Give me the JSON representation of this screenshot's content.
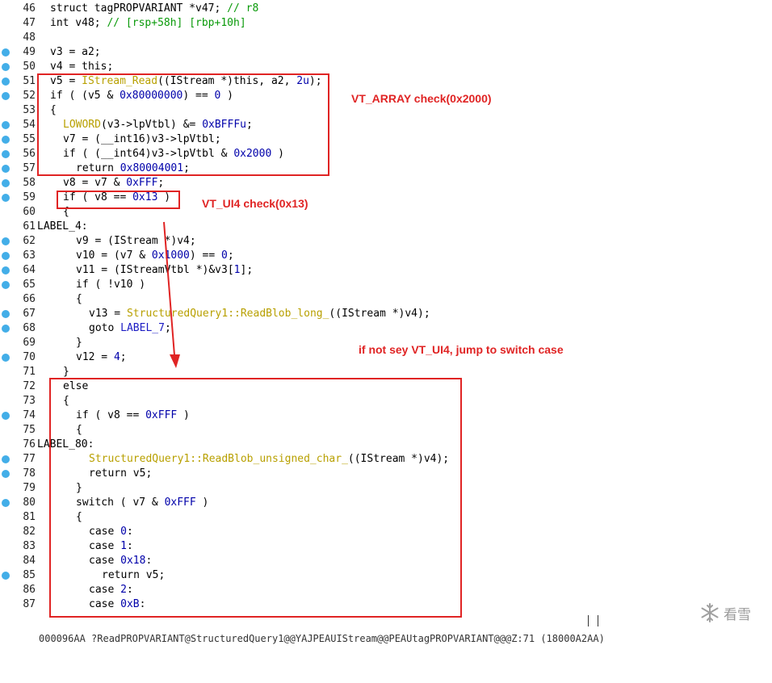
{
  "lines": [
    {
      "num": "46",
      "bp": false,
      "indent": 0,
      "tokens": [
        {
          "t": "struct tagPROPVARIANT *v47; ",
          "c": "p"
        },
        {
          "t": "// r8",
          "c": "c"
        }
      ]
    },
    {
      "num": "47",
      "bp": false,
      "indent": 0,
      "tokens": [
        {
          "t": "int v48; ",
          "c": "p"
        },
        {
          "t": "// [rsp+58h] [rbp+10h]",
          "c": "c"
        }
      ]
    },
    {
      "num": "48",
      "bp": false,
      "indent": 0,
      "tokens": []
    },
    {
      "num": "49",
      "bp": true,
      "indent": 0,
      "tokens": [
        {
          "t": "v3 = a2;",
          "c": "p"
        }
      ]
    },
    {
      "num": "50",
      "bp": true,
      "indent": 0,
      "tokens": [
        {
          "t": "v4 = this;",
          "c": "p"
        }
      ]
    },
    {
      "num": "51",
      "bp": true,
      "indent": 0,
      "tokens": [
        {
          "t": "v5 = ",
          "c": "p"
        },
        {
          "t": "IStream_Read",
          "c": "f"
        },
        {
          "t": "((IStream *)this, a2, ",
          "c": "p"
        },
        {
          "t": "2u",
          "c": "n"
        },
        {
          "t": ");",
          "c": "p"
        }
      ]
    },
    {
      "num": "52",
      "bp": true,
      "indent": 0,
      "tokens": [
        {
          "t": "if ( (v5 & ",
          "c": "p"
        },
        {
          "t": "0x80000000",
          "c": "n"
        },
        {
          "t": ") == ",
          "c": "p"
        },
        {
          "t": "0",
          "c": "n"
        },
        {
          "t": " )",
          "c": "p"
        }
      ]
    },
    {
      "num": "53",
      "bp": false,
      "indent": 0,
      "tokens": [
        {
          "t": "{",
          "c": "p"
        }
      ]
    },
    {
      "num": "54",
      "bp": true,
      "indent": 1,
      "tokens": [
        {
          "t": "LOWORD",
          "c": "f"
        },
        {
          "t": "(v3->lpVtbl) &= ",
          "c": "p"
        },
        {
          "t": "0xBFFFu",
          "c": "n"
        },
        {
          "t": ";",
          "c": "p"
        }
      ]
    },
    {
      "num": "55",
      "bp": true,
      "indent": 1,
      "tokens": [
        {
          "t": "v7 = (__int16)v3->lpVtbl;",
          "c": "p"
        }
      ]
    },
    {
      "num": "56",
      "bp": true,
      "indent": 1,
      "tokens": [
        {
          "t": "if ( (__int64)v3->lpVtbl & ",
          "c": "p"
        },
        {
          "t": "0x2000",
          "c": "n"
        },
        {
          "t": " )",
          "c": "p"
        }
      ]
    },
    {
      "num": "57",
      "bp": true,
      "indent": 2,
      "tokens": [
        {
          "t": "return ",
          "c": "p"
        },
        {
          "t": "0x80004001",
          "c": "n"
        },
        {
          "t": ";",
          "c": "p"
        }
      ]
    },
    {
      "num": "58",
      "bp": true,
      "indent": 1,
      "tokens": [
        {
          "t": "v8 = v7 & ",
          "c": "p"
        },
        {
          "t": "0xFFF",
          "c": "n"
        },
        {
          "t": ";",
          "c": "p"
        }
      ]
    },
    {
      "num": "59",
      "bp": true,
      "indent": 1,
      "tokens": [
        {
          "t": "if ( v8 == ",
          "c": "p"
        },
        {
          "t": "0x13",
          "c": "n"
        },
        {
          "t": " )",
          "c": "p"
        }
      ]
    },
    {
      "num": "60",
      "bp": false,
      "indent": 1,
      "tokens": [
        {
          "t": "{",
          "c": "p"
        }
      ]
    },
    {
      "num": "61",
      "bp": false,
      "indent": 0,
      "label": true,
      "tokens": [
        {
          "t": "LABEL_4:",
          "c": "p"
        }
      ]
    },
    {
      "num": "62",
      "bp": true,
      "indent": 2,
      "tokens": [
        {
          "t": "v9 = (IStream *)v4;",
          "c": "p"
        }
      ]
    },
    {
      "num": "63",
      "bp": true,
      "indent": 2,
      "tokens": [
        {
          "t": "v10 = (v7 & ",
          "c": "p"
        },
        {
          "t": "0x1000",
          "c": "n"
        },
        {
          "t": ") == ",
          "c": "p"
        },
        {
          "t": "0",
          "c": "n"
        },
        {
          "t": ";",
          "c": "p"
        }
      ]
    },
    {
      "num": "64",
      "bp": true,
      "indent": 2,
      "tokens": [
        {
          "t": "v11 = (IStreamVtbl *)&v3[",
          "c": "p"
        },
        {
          "t": "1",
          "c": "n"
        },
        {
          "t": "];",
          "c": "p"
        }
      ]
    },
    {
      "num": "65",
      "bp": true,
      "indent": 2,
      "tokens": [
        {
          "t": "if ( !v10 )",
          "c": "p"
        }
      ]
    },
    {
      "num": "66",
      "bp": false,
      "indent": 2,
      "tokens": [
        {
          "t": "{",
          "c": "p"
        }
      ]
    },
    {
      "num": "67",
      "bp": true,
      "indent": 3,
      "tokens": [
        {
          "t": "v13 = ",
          "c": "p"
        },
        {
          "t": "StructuredQuery1::ReadBlob_long_",
          "c": "f"
        },
        {
          "t": "((IStream *)v4);",
          "c": "p"
        }
      ]
    },
    {
      "num": "68",
      "bp": true,
      "indent": 3,
      "tokens": [
        {
          "t": "goto ",
          "c": "p"
        },
        {
          "t": "LABEL_7",
          "c": "m"
        },
        {
          "t": ";",
          "c": "p"
        }
      ]
    },
    {
      "num": "69",
      "bp": false,
      "indent": 2,
      "tokens": [
        {
          "t": "}",
          "c": "p"
        }
      ]
    },
    {
      "num": "70",
      "bp": true,
      "indent": 2,
      "tokens": [
        {
          "t": "v12 = ",
          "c": "p"
        },
        {
          "t": "4",
          "c": "n"
        },
        {
          "t": ";",
          "c": "p"
        }
      ]
    },
    {
      "num": "71",
      "bp": false,
      "indent": 1,
      "tokens": [
        {
          "t": "}",
          "c": "p"
        }
      ]
    },
    {
      "num": "72",
      "bp": false,
      "indent": 1,
      "tokens": [
        {
          "t": "else",
          "c": "p"
        }
      ]
    },
    {
      "num": "73",
      "bp": false,
      "indent": 1,
      "tokens": [
        {
          "t": "{",
          "c": "p"
        }
      ]
    },
    {
      "num": "74",
      "bp": true,
      "indent": 2,
      "tokens": [
        {
          "t": "if ( v8 == ",
          "c": "p"
        },
        {
          "t": "0xFFF",
          "c": "n"
        },
        {
          "t": " )",
          "c": "p"
        }
      ]
    },
    {
      "num": "75",
      "bp": false,
      "indent": 2,
      "tokens": [
        {
          "t": "{",
          "c": "p"
        }
      ]
    },
    {
      "num": "76",
      "bp": false,
      "indent": 0,
      "label": true,
      "tokens": [
        {
          "t": "LABEL_80:",
          "c": "p"
        }
      ]
    },
    {
      "num": "77",
      "bp": true,
      "indent": 3,
      "tokens": [
        {
          "t": "StructuredQuery1::ReadBlob_unsigned_char_",
          "c": "f"
        },
        {
          "t": "((IStream *)v4);",
          "c": "p"
        }
      ]
    },
    {
      "num": "78",
      "bp": true,
      "indent": 3,
      "tokens": [
        {
          "t": "return v5;",
          "c": "p"
        }
      ]
    },
    {
      "num": "79",
      "bp": false,
      "indent": 2,
      "tokens": [
        {
          "t": "}",
          "c": "p"
        }
      ]
    },
    {
      "num": "80",
      "bp": true,
      "indent": 2,
      "tokens": [
        {
          "t": "switch ( v7 & ",
          "c": "p"
        },
        {
          "t": "0xFFF",
          "c": "n"
        },
        {
          "t": " )",
          "c": "p"
        }
      ]
    },
    {
      "num": "81",
      "bp": false,
      "indent": 2,
      "tokens": [
        {
          "t": "{",
          "c": "p"
        }
      ]
    },
    {
      "num": "82",
      "bp": false,
      "indent": 3,
      "tokens": [
        {
          "t": "case ",
          "c": "p"
        },
        {
          "t": "0",
          "c": "n"
        },
        {
          "t": ":",
          "c": "p"
        }
      ]
    },
    {
      "num": "83",
      "bp": false,
      "indent": 3,
      "tokens": [
        {
          "t": "case ",
          "c": "p"
        },
        {
          "t": "1",
          "c": "n"
        },
        {
          "t": ":",
          "c": "p"
        }
      ]
    },
    {
      "num": "84",
      "bp": false,
      "indent": 3,
      "tokens": [
        {
          "t": "case ",
          "c": "p"
        },
        {
          "t": "0x18",
          "c": "n"
        },
        {
          "t": ":",
          "c": "p"
        }
      ]
    },
    {
      "num": "85",
      "bp": true,
      "indent": 4,
      "tokens": [
        {
          "t": "return v5;",
          "c": "p"
        }
      ]
    },
    {
      "num": "86",
      "bp": false,
      "indent": 3,
      "tokens": [
        {
          "t": "case ",
          "c": "p"
        },
        {
          "t": "2",
          "c": "n"
        },
        {
          "t": ":",
          "c": "p"
        }
      ]
    },
    {
      "num": "87",
      "bp": false,
      "indent": 3,
      "tokens": [
        {
          "t": "case ",
          "c": "p"
        },
        {
          "t": "0xB",
          "c": "n"
        },
        {
          "t": ":",
          "c": "p"
        }
      ]
    }
  ],
  "annotations": {
    "vt_array": "VT_ARRAY check(0x2000)",
    "vt_ui4": "VT_UI4 check(0x13)",
    "jump": "if not sey VT_UI4,   jump to switch case"
  },
  "status_bar": {
    "text": "000096AA ?ReadPROPVARIANT@StructuredQuery1@@YAJPEAUIStream@@PEAUtagPROPVARIANT@@@Z:71 (18000A2AA)"
  },
  "watermark": {
    "icon": "snowflake-icon",
    "text": "看雪"
  },
  "colors": {
    "annotation": "#e02424",
    "breakpoint": "#43aee8",
    "function": "#b8a000",
    "number": "#0000aa",
    "comment": "#0a9a0a"
  }
}
